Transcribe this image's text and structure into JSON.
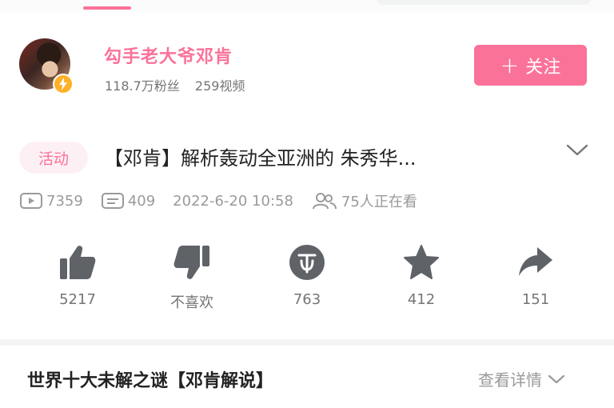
{
  "uploader": {
    "name": "勾手老大爷邓肯",
    "followers": "118.7万粉丝",
    "videos": "259视频",
    "follow_label": "关注"
  },
  "video": {
    "tag": "活动",
    "title": "【邓肯】解析轰动全亚洲的 朱秀华...",
    "views": "7359",
    "comments": "409",
    "datetime": "2022-6-20 10:58",
    "watching": "75人正在看"
  },
  "actions": [
    {
      "icon": "thumbs-up-icon",
      "label": "5217"
    },
    {
      "icon": "thumbs-down-icon",
      "label": "不喜欢"
    },
    {
      "icon": "coin-icon",
      "label": "763"
    },
    {
      "icon": "star-icon",
      "label": "412"
    },
    {
      "icon": "share-icon",
      "label": "151"
    }
  ],
  "collection": {
    "title": "世界十大未解之谜【邓肯解说】",
    "detail_label": "查看详情"
  },
  "colors": {
    "accent": "#fb7299",
    "icon": "#5f6368",
    "muted": "#9a9a9a"
  }
}
